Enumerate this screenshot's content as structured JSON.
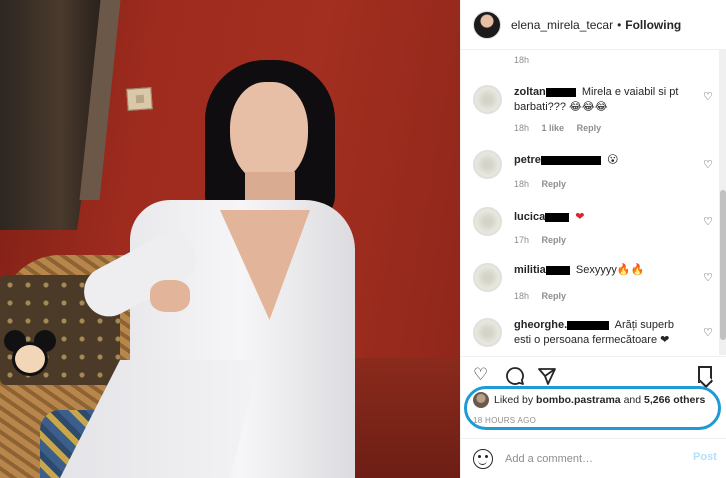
{
  "post": {
    "username": "elena_mirela_tecar",
    "separator": "•",
    "follow_status": "Following"
  },
  "top_time": "18h",
  "comments": [
    {
      "user": "zoltan",
      "text": "Mirela e vaiabil si pt barbati??? 😂😂😂",
      "time": "18h",
      "likes": "1 like",
      "reply": "Reply"
    },
    {
      "user": "petre",
      "text": "😮",
      "time": "18h",
      "reply": "Reply"
    },
    {
      "user": "lucica",
      "text": "❤",
      "time": "17h",
      "reply": "Reply"
    },
    {
      "user": "militia",
      "text": "Sexyyyy🔥🔥",
      "time": "18h",
      "reply": "Reply"
    },
    {
      "user": "gheorghe.",
      "text": "Arăți superb esti o persoana fermecătoare ❤",
      "time": "",
      "reply": ""
    }
  ],
  "actions": {
    "like_icon": "heart-icon",
    "comment_icon": "comment-icon",
    "share_icon": "share-icon",
    "save_icon": "bookmark-icon"
  },
  "likes": {
    "prefix": "Liked by",
    "user": "bombo.pastrama",
    "middle": "and",
    "others": "5,266 others"
  },
  "timestamp": "18 HOURS AGO",
  "add_comment": {
    "placeholder": "Add a comment…",
    "post_label": "Post"
  },
  "colors": {
    "highlight": "#1e9ad6",
    "post_disabled": "#b2dffc",
    "heart_red": "#e0212b"
  }
}
